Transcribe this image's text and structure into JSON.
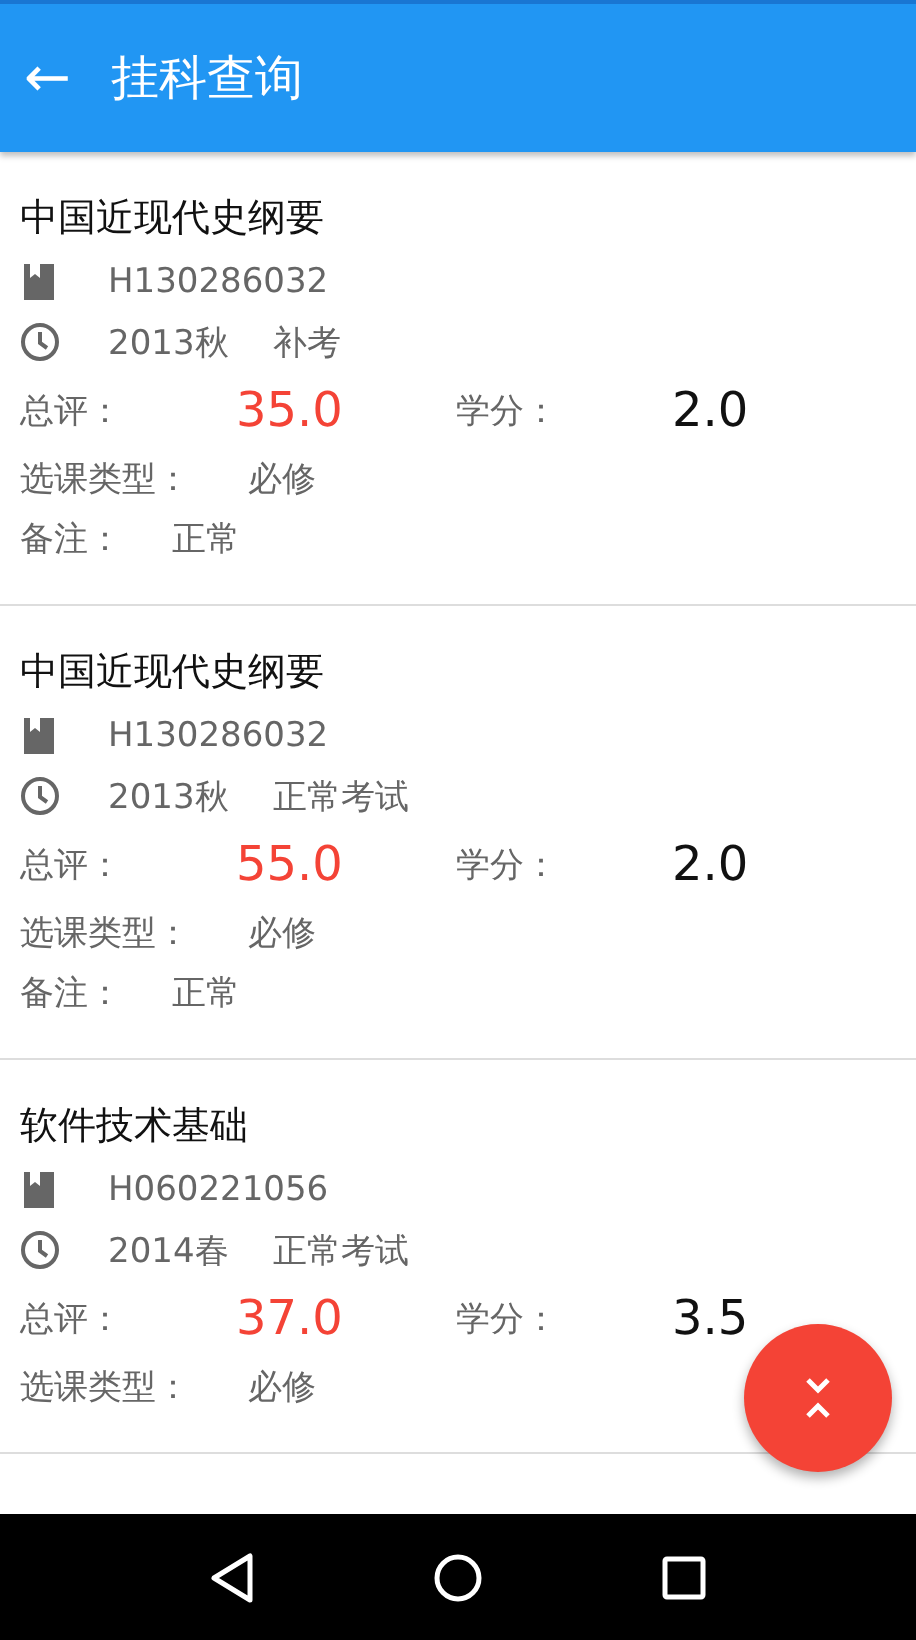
{
  "app_bar": {
    "back_icon": "←",
    "title": "挂科查询"
  },
  "courses": [
    {
      "name": "中国近现代史纲要",
      "code": "H130286032",
      "term": "2013秋",
      "exam_type": "补考",
      "score_label": "总评：",
      "score": "35.0",
      "credit_label": "学分：",
      "credit": "2.0",
      "type_label": "选课类型：",
      "type": "必修",
      "note_label": "备注：",
      "note": "正常"
    },
    {
      "name": "中国近现代史纲要",
      "code": "H130286032",
      "term": "2013秋",
      "exam_type": "正常考试",
      "score_label": "总评：",
      "score": "55.0",
      "credit_label": "学分：",
      "credit": "2.0",
      "type_label": "选课类型：",
      "type": "必修",
      "note_label": "备注：",
      "note": "正常"
    },
    {
      "name": "软件技术基础",
      "code": "H060221056",
      "term": "2014春",
      "exam_type": "正常考试",
      "score_label": "总评：",
      "score": "37.0",
      "credit_label": "学分：",
      "credit": "3.5",
      "type_label": "选课类型：",
      "type": "必修"
    }
  ]
}
